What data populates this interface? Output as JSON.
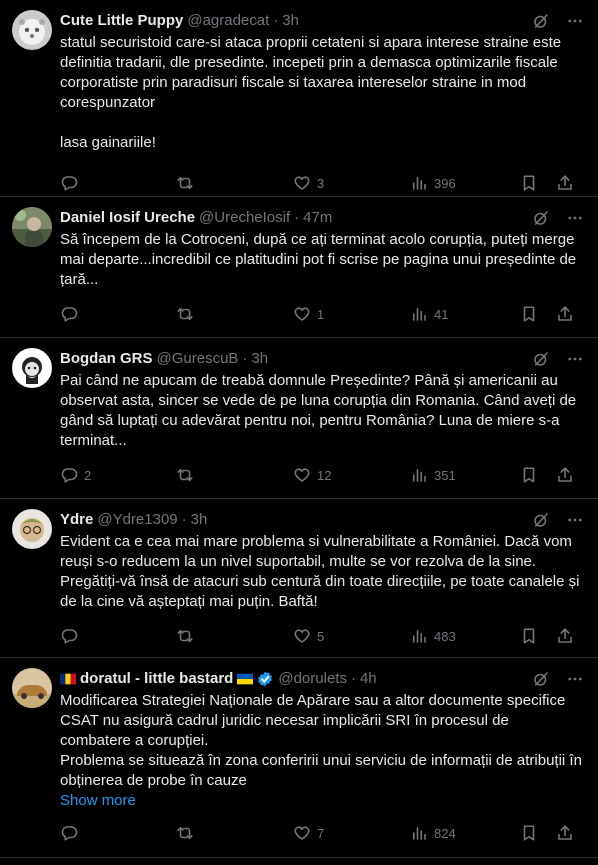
{
  "tweets": [
    {
      "name": "Cute Little Puppy",
      "handle": "@agradecat",
      "time": "3h",
      "text": "statul securistoid care-si ataca proprii cetateni si apara interese straine este definitia tradarii, dle presedinte. incepeti prin a demasca optimizarile fiscale corporatiste prin paradisuri fiscale si taxarea intereselor straine in mod corespunzator\n\nlasa gainariile!",
      "replies": "",
      "reposts": "",
      "likes": "3",
      "views": "396"
    },
    {
      "name": "Daniel Iosif Ureche",
      "handle": "@UrecheIosif",
      "time": "47m",
      "text": "Să începem de la Cotroceni, după ce ați terminat acolo corupția, puteți merge mai departe...incredibil ce platitudini pot fi scrise pe pagina unui președinte de țară...",
      "replies": "",
      "reposts": "",
      "likes": "1",
      "views": "41"
    },
    {
      "name": "Bogdan GRS",
      "handle": "@GurescuB",
      "time": "3h",
      "text": "Pai când ne apucam de treabă domnule Președinte? Până și americanii au observat asta, sincer se vede de pe luna corupția din Romania. Când aveți de gând să luptați cu adevărat pentru noi, pentru România? Luna de miere s-a terminat...",
      "replies": "2",
      "reposts": "",
      "likes": "12",
      "views": "351"
    },
    {
      "name": "Ydre",
      "handle": "@Ydre1309",
      "time": "3h",
      "text": "Evident ca e cea mai mare problema si vulnerabilitate a României. Dacă vom reuși s-o reducem la un nivel suportabil, multe se vor rezolva de la sine. Pregătiți-vă însă de atacuri sub centură din toate direcțiile, pe toate canalele și de la cine vă așteptați mai puțin. Baftă!",
      "replies": "",
      "reposts": "",
      "likes": "5",
      "views": "483"
    },
    {
      "name": "doratul - little bastard",
      "handle": "@dorulets",
      "time": "4h",
      "text": "Modificarea Strategiei Naționale de Apărare sau a altor documente specifice CSAT nu asigură cadrul juridic necesar implicării SRI în procesul de combatere a corupției.\nProblema se situează în zona conferirii unui serviciu de informații de atribuții în obținerea de probe în cauze",
      "show_more": "Show more",
      "replies": "",
      "reposts": "",
      "likes": "7",
      "views": "824"
    }
  ],
  "separator": "·",
  "icons": {
    "reply": "reply-icon",
    "repost": "repost-icon",
    "like": "heart-icon",
    "views": "views-chart-icon",
    "bookmark": "bookmark-icon",
    "share": "share-icon",
    "grok": "grok-icon",
    "more": "more-icon",
    "verified": "verified-badge-icon"
  },
  "colors": {
    "background": "#000000",
    "text": "#e7e9ea",
    "muted": "#71767b",
    "link": "#1d9bf0",
    "verified": "#1d9bf0",
    "divider": "#2f3336"
  }
}
